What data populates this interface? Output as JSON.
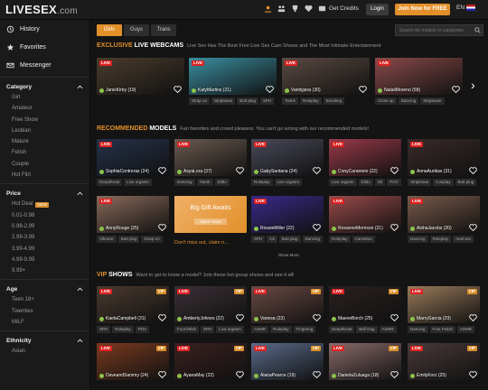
{
  "header": {
    "logo": "LIVESEX",
    "logo_domain": ".com",
    "credits_label": "Get Credits",
    "login_label": "Login",
    "join_label": "Join Now for FREE",
    "lang": "EN"
  },
  "sidebar": {
    "nav": [
      {
        "label": "History",
        "icon": "history-icon"
      },
      {
        "label": "Favorites",
        "icon": "star-icon"
      },
      {
        "label": "Messenger",
        "icon": "envelope-icon"
      }
    ],
    "category": {
      "title": "Category",
      "items": [
        "Girl",
        "Amateur",
        "Free Show",
        "Lesbian",
        "Mature",
        "Fetish",
        "Couple",
        "Hot Flirt"
      ]
    },
    "price": {
      "title": "Price",
      "items": [
        "Hot Deal",
        "0.01-0.98",
        "0.98-2.99",
        "2.99-3.99",
        "3.99-4.99",
        "4.99-9.99",
        "9.99+"
      ],
      "new_badge": "NEW"
    },
    "age": {
      "title": "Age",
      "items": [
        "Teen 18+",
        "Twenties",
        "MILF"
      ]
    },
    "ethnicity": {
      "title": "Ethnicity",
      "items": [
        "Asian"
      ]
    }
  },
  "tabs": [
    "Girls",
    "Guys",
    "Trans"
  ],
  "search": {
    "placeholder": "Search for models or categories"
  },
  "sections": {
    "exclusive": {
      "t1": "EXCLUSIVE",
      "t2": " LIVE WEBCAMS",
      "sub": "Live Sex Has The Best Free Live Sex Cam Shows and The Most Intimate Entertainment"
    },
    "recommended": {
      "t1": "RECOMMENDED",
      "t2": " MODELS",
      "sub": "Fan favorites and crowd pleasers. You can't go wrong with our recommended models!"
    },
    "vip": {
      "t1": "VIP",
      "t2": " SHOWS",
      "sub": "Want to get to know a model? Join these hot group shows and see it all!"
    }
  },
  "exclusive_cards": [
    {
      "name": "JanisKirby (19)",
      "tags": [],
      "color": "#4a3c2e"
    },
    {
      "name": "KatyMartins (21)",
      "tags": [
        "Strap on",
        "Striptease",
        "Butt plug",
        "SPH"
      ],
      "color": "#3a8ea0"
    },
    {
      "name": "Vanityjess (30)",
      "tags": [
        "Twerk",
        "Roleplay",
        "Smoking"
      ],
      "color": "#5a4a42"
    },
    {
      "name": "NataliMoreno (58)",
      "tags": [
        "Close up",
        "Dancing",
        "Striptease"
      ],
      "color": "#8a4a4a"
    }
  ],
  "recommended_row1": [
    {
      "name": "SophiaContreras (24)",
      "tags": [
        "Deepthroat",
        "Live orgasm"
      ],
      "color": "#26324a"
    },
    {
      "name": "AsyaLora (37)",
      "tags": [
        "Dancing",
        "Twerk",
        "Dildo"
      ],
      "color": "#6a5a50"
    },
    {
      "name": "GabySantana (24)",
      "tags": [
        "Roleplay",
        "Live orgasm"
      ],
      "color": "#4a4a5a"
    },
    {
      "name": "ConyCarameio (22)",
      "tags": [
        "Live orgasm",
        "Dildo",
        "Oil",
        "POV"
      ],
      "color": "#9a3a4a"
    },
    {
      "name": "AnnaAurikas (31)",
      "tags": [
        "Striptease",
        "Cosplay",
        "Butt plug"
      ],
      "color": "#3a2a2a"
    }
  ],
  "recommended_row2": [
    {
      "name": "AnnyRouge (25)",
      "tags": [
        "Vibrator",
        "Butt plug",
        "Strap-on"
      ],
      "color": "#8a6a5a"
    },
    {
      "name": "RossieMiller (22)",
      "tags": [
        "SPH",
        "Oil",
        "Butt plug",
        "Dancing"
      ],
      "color": "#3a2a8a"
    },
    {
      "name": "RoxanneMorrison (21)",
      "tags": [
        "Roleplay",
        "Cameltoe"
      ],
      "color": "#9a4a4a"
    },
    {
      "name": "AishaJacobs (20)",
      "tags": [
        "Dancing",
        "Roleplay",
        "Anal sex"
      ],
      "color": "#7a5a4a"
    }
  ],
  "promo": {
    "title": "Big Gift Awaits",
    "button": "Open Yours",
    "text": "Don't miss out, claim n..."
  },
  "show_more": "Show More",
  "vip_row1": [
    {
      "name": "KaelaCampbell (31)",
      "tags": [
        "SPH",
        "Roleplay",
        "POV"
      ],
      "color": "#4a3a30"
    },
    {
      "name": "AmberlyJohnes (22)",
      "tags": [
        "Foot fetish",
        "SPH",
        "Live orgasm"
      ],
      "color": "#3a3036"
    },
    {
      "name": "Vanesa (23)",
      "tags": [
        "ASMR",
        "Roleplay",
        "Fingering"
      ],
      "color": "#6a4a44"
    },
    {
      "name": "MaeveBorch (25)",
      "tags": [
        "Deepthroat",
        "Ball Gag",
        "ASMR"
      ],
      "color": "#2a2020"
    },
    {
      "name": "MarryGarcia (29)",
      "tags": [
        "Dancing",
        "Foot Fetish",
        "ASMR"
      ],
      "color": "#9a7a5a"
    }
  ],
  "vip_row2": [
    {
      "name": "DaveandSammy (24)",
      "tags": [],
      "color": "#7a3a20"
    },
    {
      "name": "AyanaMay (22)",
      "tags": [],
      "color": "#3a2020"
    },
    {
      "name": "AlanaPearce (19)",
      "tags": [],
      "color": "#5a6a8a"
    },
    {
      "name": "DanielaZuluaga (18)",
      "tags": [],
      "color": "#8a6a6a"
    },
    {
      "name": "EmilyKorz (25)",
      "tags": [],
      "color": "#4a3a3a"
    }
  ],
  "labels": {
    "live": "LIVE",
    "vip": "VIP",
    "new": "New"
  },
  "colors": {
    "accent": "#e2902a",
    "live": "#dd2222",
    "online": "#8bc34a"
  }
}
